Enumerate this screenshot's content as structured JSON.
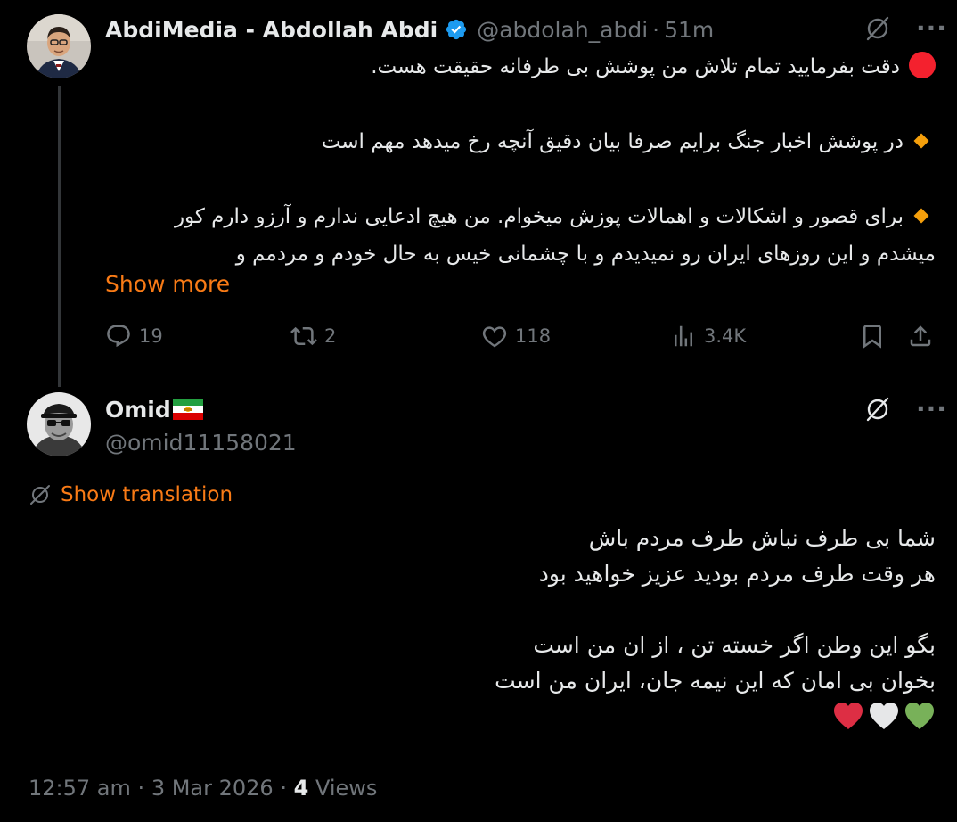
{
  "tweet": {
    "display_name": "AbdiMedia - Abdollah Abdi",
    "handle": "@abdolah_abdi",
    "separator": "·",
    "time": "51m",
    "lines": [
      "دقت بفرمایید تمام تلاش من پوشش بی طرفانه حقیقت هست.",
      "در پوشش اخبار جنگ برایم صرفا بیان دقیق آنچه رخ میدهد مهم است",
      "برای قصور و اشکالات و اهمالات پوزش میخوام. من هیچ ادعایی ندارم و آرزو دارم کور",
      "میشدم و این روزهای ایران رو نمیدیدم و با چشمانی خیس به حال خودم و مردمم و"
    ],
    "show_more": "Show more",
    "stats": {
      "replies": "19",
      "reposts": "2",
      "likes": "118",
      "views": "3.4K"
    }
  },
  "reply": {
    "display_name": "Omid",
    "handle": "@omid11158021",
    "show_translation": "Show translation",
    "lines": [
      "شما بی طرف نباش طرف مردم باش",
      "هر وقت طرف مردم بودید عزیز خواهید بود",
      "بگو این وطن اگر خسته تن ، از ان من است",
      "بخوان بی امان که این نیمه جان، ایران من است"
    ],
    "hearts": [
      "green-heart-icon",
      "white-heart-icon",
      "red-heart-icon"
    ],
    "timestamp": "12:57 am",
    "date": "3 Mar 2026",
    "separator": "·",
    "views_count": "4",
    "views_label": "Views"
  },
  "colors": {
    "background": "#000000",
    "text_primary": "#e7e9ea",
    "text_secondary": "#71767b",
    "accent": "#f97b16",
    "verified": "#1d9bf0"
  }
}
